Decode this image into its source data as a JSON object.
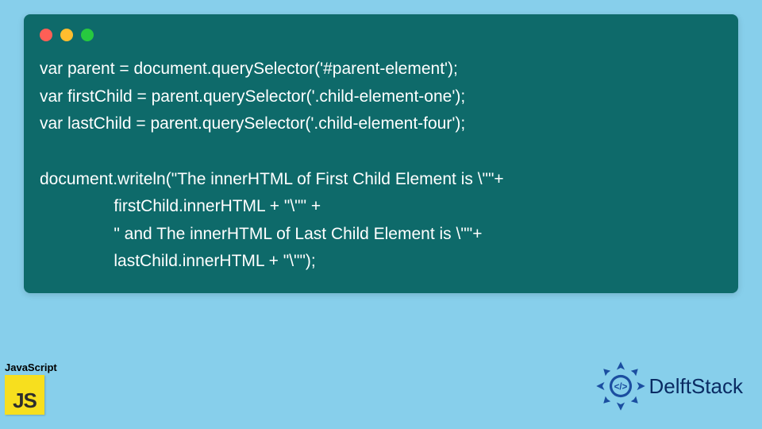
{
  "code": {
    "line1": "var parent = document.querySelector('#parent-element');",
    "line2": "var firstChild = parent.querySelector('.child-element-one');",
    "line3": "var lastChild = parent.querySelector('.child-element-four');",
    "line4": "",
    "line5": "document.writeln(\"The innerHTML of First Child Element is \\\"\"+",
    "line6": "                firstChild.innerHTML + \"\\\"\" +",
    "line7": "                \" and The innerHTML of Last Child Element is \\\"\"+",
    "line8": "                lastChild.innerHTML + \"\\\"\");"
  },
  "jsBadge": {
    "label": "JavaScript",
    "short": "JS"
  },
  "brand": {
    "name": "DelftStack"
  },
  "colors": {
    "pageBg": "#87cfeb",
    "windowBg": "#0e6a6a",
    "codeText": "#ffffff",
    "jsYellow": "#f7df1e",
    "brandBlue": "#0a2b63"
  }
}
